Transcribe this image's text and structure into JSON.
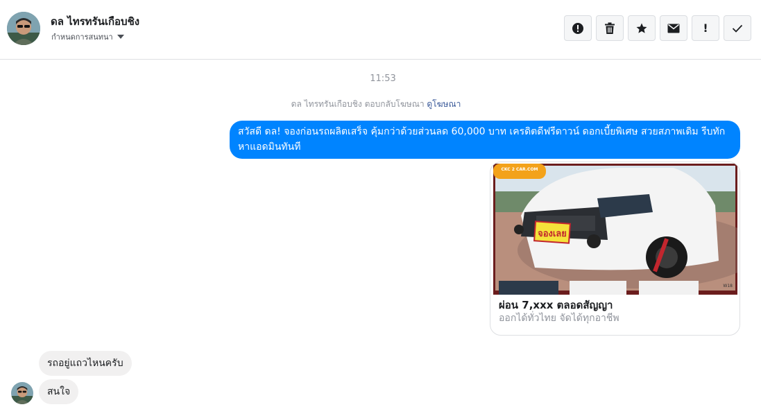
{
  "header": {
    "contact_name": "ดล ไทรทรันเกือบชิง",
    "conversation_menu": "กำหนดการสนทนา"
  },
  "toolbar": {
    "buttons": [
      {
        "icon": "alert-circle-icon"
      },
      {
        "icon": "trash-icon"
      },
      {
        "icon": "star-icon"
      },
      {
        "icon": "envelope-icon"
      },
      {
        "label": "!",
        "icon": "exclamation-icon"
      },
      {
        "icon": "checkmark-icon"
      }
    ]
  },
  "thread": {
    "timestamp": "11:53",
    "reply_note": "ดล ไทรทรันเกือบชิง ตอบกลับโฆษณา",
    "reply_link": "ดูโฆษณา",
    "outgoing_message": "สวัสดี ดล! จองก่อนรถผลิตเสร็จ คุ้มกว่าด้วยส่วนลด 60,000 บาท เครดิตดีฟรีดาวน์ ดอกเบี้ยพิเศษ สวยสภาพเดิม รีบทักหาแอดมินทันที",
    "ad": {
      "badge_text": "CKC 2 CAR.COM",
      "plate_text": "จองเลย",
      "corner_text": "W18",
      "title": "ผ่อน 7,xxx ตลอดสัญญา",
      "subtitle": "ออกได้ทั่วไทย จัดได้ทุกอาชีพ"
    },
    "incoming_messages": [
      "รถอยู่แถวไหนครับ",
      "สนใจ"
    ]
  },
  "colors": {
    "accent": "#0084ff",
    "incoming_bubble": "#f1f0f0",
    "link": "#385898",
    "muted_text": "#90949c"
  }
}
